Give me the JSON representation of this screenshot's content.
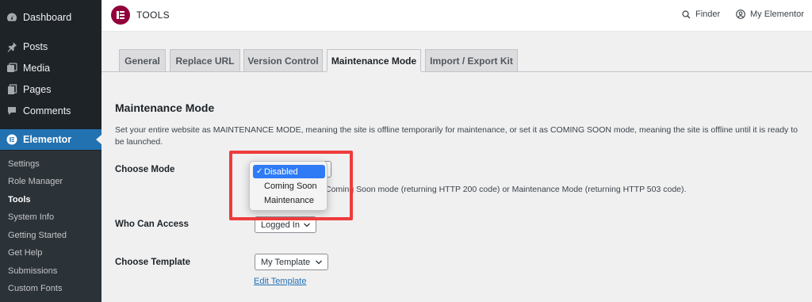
{
  "sidebar": {
    "items": [
      {
        "label": "Dashboard",
        "icon": "dashboard-icon"
      },
      {
        "label": "Posts",
        "icon": "pushpin-icon"
      },
      {
        "label": "Media",
        "icon": "media-icon"
      },
      {
        "label": "Pages",
        "icon": "pages-icon"
      },
      {
        "label": "Comments",
        "icon": "comments-icon"
      },
      {
        "label": "Elementor",
        "icon": "elementor-icon"
      }
    ],
    "submenu": [
      "Settings",
      "Role Manager",
      "Tools",
      "System Info",
      "Getting Started",
      "Get Help",
      "Submissions",
      "Custom Fonts"
    ],
    "active_submenu": "Tools"
  },
  "topbar": {
    "title": "TOOLS",
    "finder": "Finder",
    "account": "My Elementor"
  },
  "tabs": [
    "General",
    "Replace URL",
    "Version Control",
    "Maintenance Mode",
    "Import / Export Kit"
  ],
  "active_tab": "Maintenance Mode",
  "section": {
    "title": "Maintenance Mode",
    "description": "Set your entire website as MAINTENANCE MODE, meaning the site is offline temporarily for maintenance, or set it as COMING SOON mode, meaning the site is offline until it is ready to be launched."
  },
  "fields": {
    "choose_mode": {
      "label": "Choose Mode",
      "selected": "Disabled",
      "options": [
        "Disabled",
        "Coming Soon",
        "Maintenance"
      ],
      "help": "Coming Soon mode (returning HTTP 200 code) or Maintenance Mode (returning HTTP 503 code)."
    },
    "who_can_access": {
      "label": "Who Can Access",
      "value": "Logged In"
    },
    "choose_template": {
      "label": "Choose Template",
      "value": "My Template",
      "edit_link": "Edit Template"
    }
  },
  "colors": {
    "sidebar_bg": "#1d2327",
    "accent": "#2271b1",
    "brand": "#92003b",
    "highlight": "#ee3b3b"
  }
}
